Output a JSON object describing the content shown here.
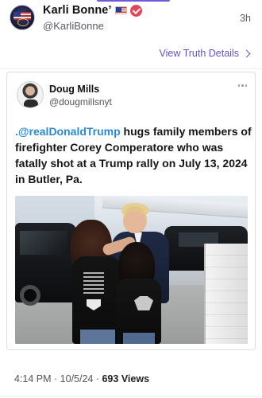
{
  "post": {
    "author_name": "Karli Bonne’",
    "author_handle": "@KarliBonne",
    "time_ago": "3h",
    "view_details_label": "View Truth Details"
  },
  "embed": {
    "author_name": "Doug Mills",
    "author_handle": "@dougmillsnyt",
    "mention": ".@realDonaldTrump",
    "text": " hugs family members of firefighter Corey Comperatore who was fatally shot at a Trump rally on July 13, 2024 in Butler, Pa."
  },
  "footer": {
    "timestamp": "4:14 PM · 10/5/24 · ",
    "views_count": "693",
    "views_label": " Views"
  },
  "colors": {
    "accent": "#6650d2",
    "mention": "#2a8ad6",
    "verified_badge": "#e2465b"
  },
  "icons": [
    "us-flag-icon",
    "verified-badge-icon",
    "chevron-right-icon",
    "more-options-icon"
  ]
}
